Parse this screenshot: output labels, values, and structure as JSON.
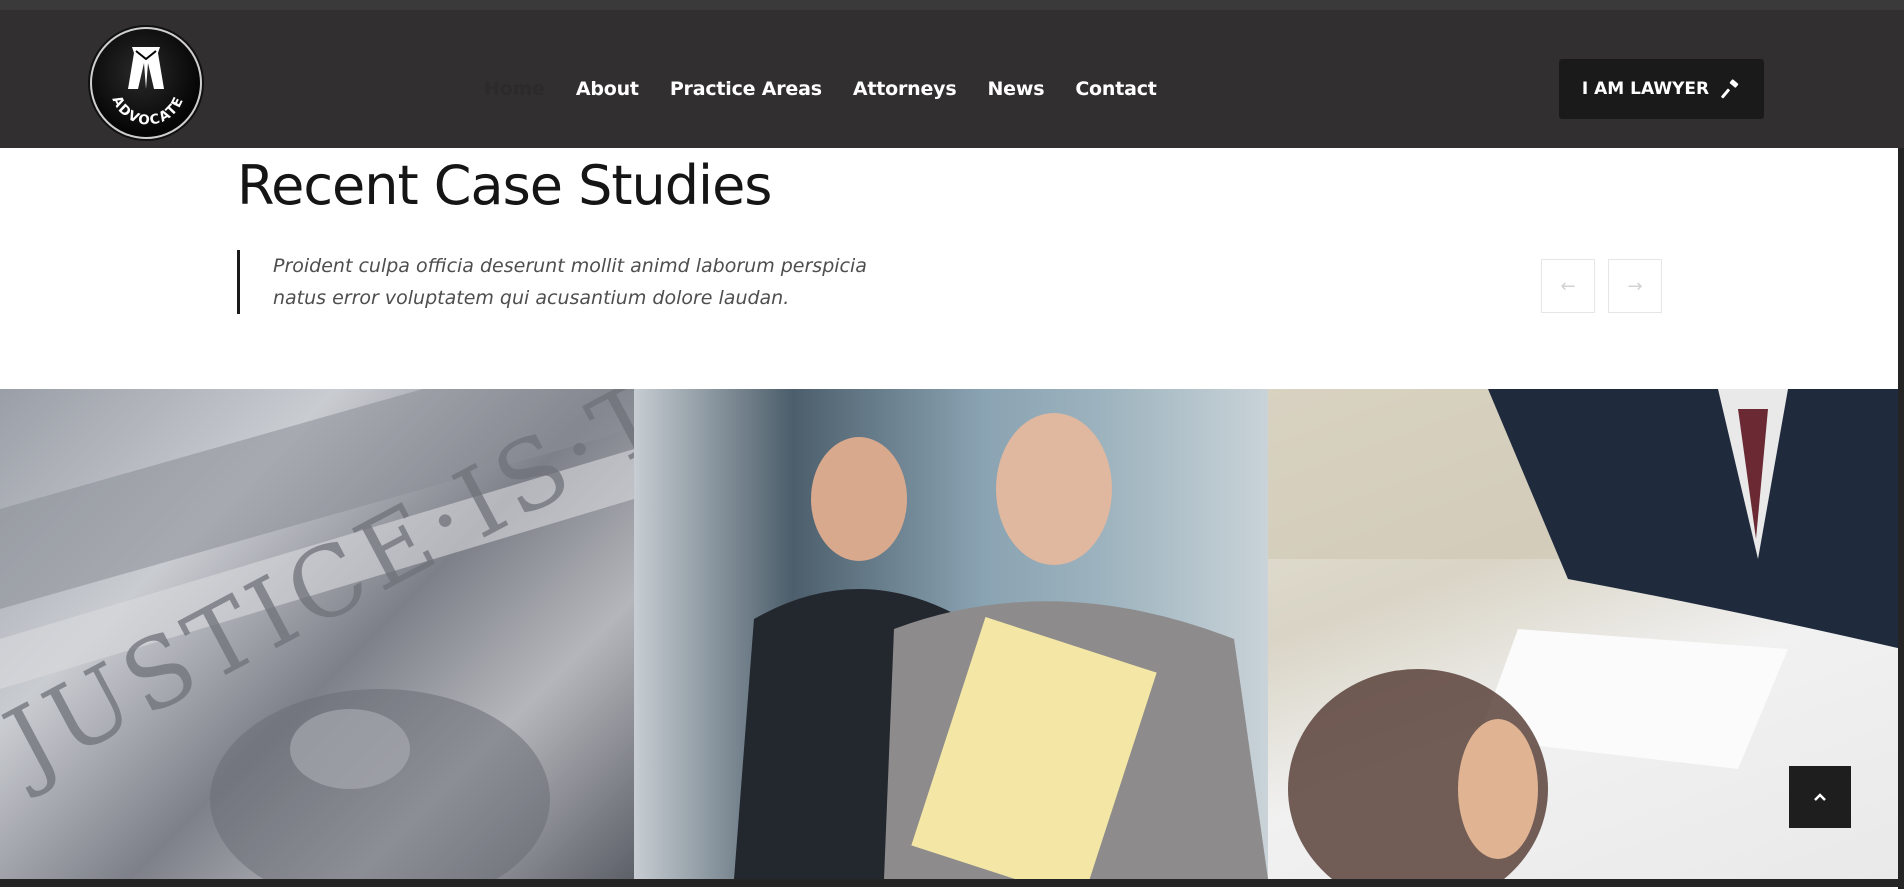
{
  "brand": {
    "logo_text": "ADVOCATE"
  },
  "nav": {
    "items": [
      {
        "label": "Home",
        "active": true
      },
      {
        "label": "About"
      },
      {
        "label": "Practice Areas"
      },
      {
        "label": "Attorneys"
      },
      {
        "label": "News"
      },
      {
        "label": "Contact"
      }
    ],
    "cta_label": "I AM LAWYER",
    "cta_icon": "gavel-icon"
  },
  "case_studies": {
    "title": "Recent Case Studies",
    "quote_line1": "Proident culpa officia deserunt mollit animd laborum perspicia",
    "quote_line2": "natus error voluptatem qui acusantium dolore laudan.",
    "prev_icon": "arrow-left-icon",
    "next_icon": "arrow-right-icon",
    "images": [
      {
        "name": "justice-column-image",
        "engraving": "JUSTICE·IS·T"
      },
      {
        "name": "lawyers-walking-image"
      },
      {
        "name": "client-meeting-image"
      }
    ]
  },
  "scroll_top_icon": "chevron-up-icon",
  "colors": {
    "header_bg": "#312f30",
    "nav_text": "#ffffff",
    "cta_bg": "#1b1a1a",
    "title_text": "#151515",
    "quote_text": "#4e4e4e"
  }
}
